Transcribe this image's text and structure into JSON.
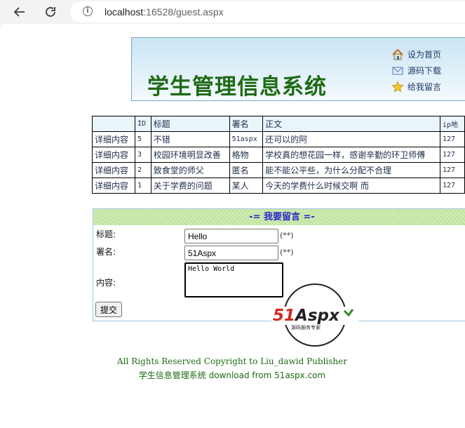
{
  "browser": {
    "url_host": "localhost",
    "url_rest": ":16528/guest.aspx"
  },
  "banner": {
    "title": "学生管理信息系统",
    "links": [
      {
        "label": "设为首页",
        "icon": "home-icon"
      },
      {
        "label": "源码下载",
        "icon": "envelope-icon"
      },
      {
        "label": "给我留言",
        "icon": "star-icon"
      }
    ]
  },
  "table": {
    "headers": [
      "",
      "ID",
      "标题",
      "署名",
      "正文",
      "ip地"
    ],
    "rows": [
      {
        "detail": "详细内容",
        "id": "5",
        "title": "不错",
        "author": "51aspx",
        "body": "还可以的阿",
        "ip": "127"
      },
      {
        "detail": "详细内容",
        "id": "3",
        "title": "校园环境明显改善",
        "author": "格物",
        "body": "学校真的想花园一样，感谢辛勤的环卫师傅",
        "ip": "127"
      },
      {
        "detail": "详细内容",
        "id": "2",
        "title": "致食堂的师父",
        "author": "匿名",
        "body": "能不能公平些，为什么分配不合理",
        "ip": "127"
      },
      {
        "detail": "详细内容",
        "id": "1",
        "title": "关于学费的问题",
        "author": "某人",
        "body": "今天的学费什么时候交啊 而",
        "ip": "127"
      }
    ]
  },
  "form": {
    "heading": "-= 我要留言 =-",
    "title_label": "标题:",
    "title_value": "Hello",
    "author_label": "署名:",
    "author_value": "51Aspx",
    "required_mark": "(**)",
    "content_label": "内容:",
    "content_value": "Hello World",
    "submit_label": "提交"
  },
  "logo": {
    "text": "51Aspx",
    "tagline": "源码服务专家"
  },
  "footer": {
    "line1": "All Rights Reserved    Copyright to Liu_dawid Publisher",
    "line2": "学生信息管理系统 download from 51aspx.com"
  },
  "colors": {
    "title_green": "#1e6a14",
    "heading_blue": "#2a2ac9",
    "logo_red": "#d12a1f",
    "logo_green": "#2f8a2a"
  }
}
